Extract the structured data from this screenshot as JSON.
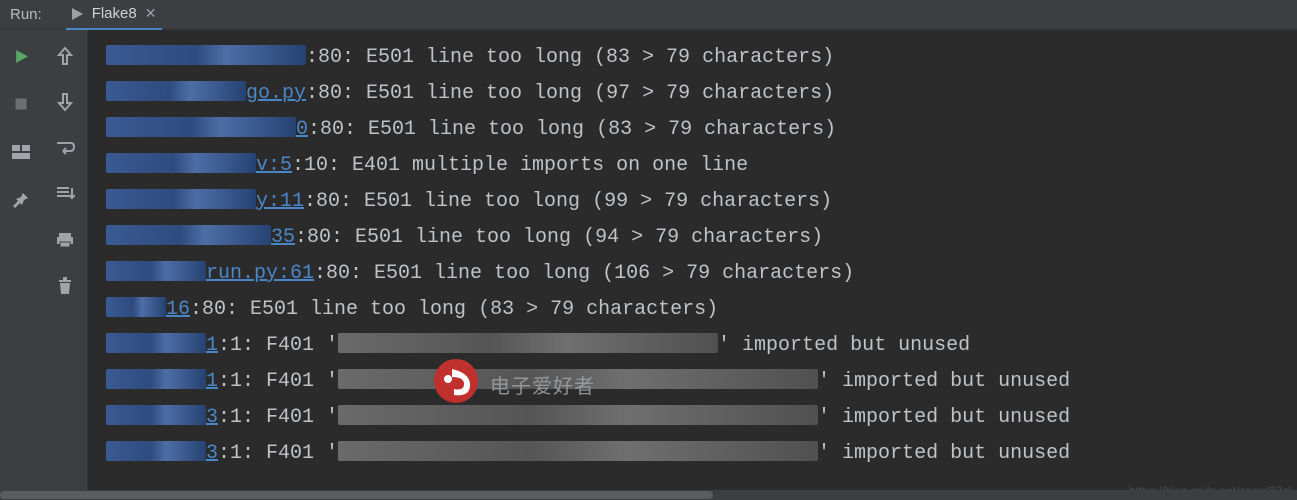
{
  "header": {
    "run_label": "Run:",
    "tab_label": "Flake8"
  },
  "lines": [
    {
      "redact_w": 200,
      "link": "",
      "rest": ":80: E501 line too long (83 > 79 characters)"
    },
    {
      "redact_w": 140,
      "link": "go.py",
      "rest": ":80: E501 line too long (97 > 79 characters)"
    },
    {
      "redact_w": 190,
      "link": "0",
      "rest": ":80: E501 line too long (83 > 79 characters)"
    },
    {
      "redact_w": 150,
      "link": "v:5",
      "rest": ":10: E401 multiple imports on one line"
    },
    {
      "redact_w": 150,
      "link": "y:11",
      "rest": ":80: E501 line too long (99 > 79 characters)"
    },
    {
      "redact_w": 165,
      "link": "35",
      "rest": ":80: E501 line too long (94 > 79 characters)"
    },
    {
      "redact_w": 100,
      "link": "run.py:61",
      "rest": ":80: E501 line too long (106 > 79 characters)"
    },
    {
      "redact_w": 60,
      "link": "16",
      "rest": ":80: E501 line too long (83 > 79 characters)",
      "indent": -6
    },
    {
      "redact_w": 100,
      "link": "1",
      "rest": ":1: F401 '",
      "redact2_w": 380,
      "rest2": "' imported but unused"
    },
    {
      "redact_w": 100,
      "link": "1",
      "rest": ":1: F401 '",
      "redact2_w": 480,
      "rest2": "' imported but unused"
    },
    {
      "redact_w": 100,
      "link": "3",
      "rest": ":1: F401 '",
      "redact2_w": 480,
      "rest2": "' imported but unused"
    },
    {
      "redact_w": 100,
      "link": "3",
      "rest": ":1: F401 '",
      "redact2_w": 480,
      "rest2": "' imported but unused"
    }
  ],
  "watermark_text": "电子爱好者",
  "csdn_watermark": "https://blog.csdn.net/angel23cl"
}
